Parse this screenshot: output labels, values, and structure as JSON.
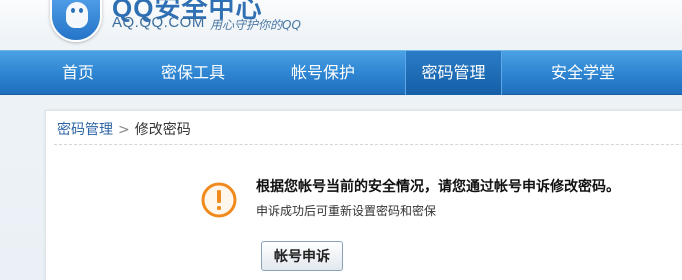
{
  "header": {
    "title": "QQ安全中心",
    "domain": "AQ.QQ.COM",
    "slogan": "用心守护你的QQ"
  },
  "nav": {
    "items": [
      {
        "label": "首页"
      },
      {
        "label": "密保工具"
      },
      {
        "label": "帐号保护"
      },
      {
        "label": "密码管理",
        "active": true
      },
      {
        "label": "安全学堂"
      }
    ]
  },
  "breadcrumb": {
    "parent": "密码管理",
    "separator": ">",
    "current": "修改密码"
  },
  "message": {
    "main": "根据您帐号当前的安全情况，请您通过帐号申诉修改密码。",
    "sub": "申诉成功后可重新设置密码和密保"
  },
  "actions": {
    "appeal_label": "帐号申诉"
  },
  "icons": {
    "logo": "qq-shield-logo-icon",
    "warning": "exclamation-circle-icon"
  },
  "colors": {
    "nav_blue": "#2f86d3",
    "warning_orange": "#f08a1c",
    "link_blue": "#2d64a5"
  }
}
